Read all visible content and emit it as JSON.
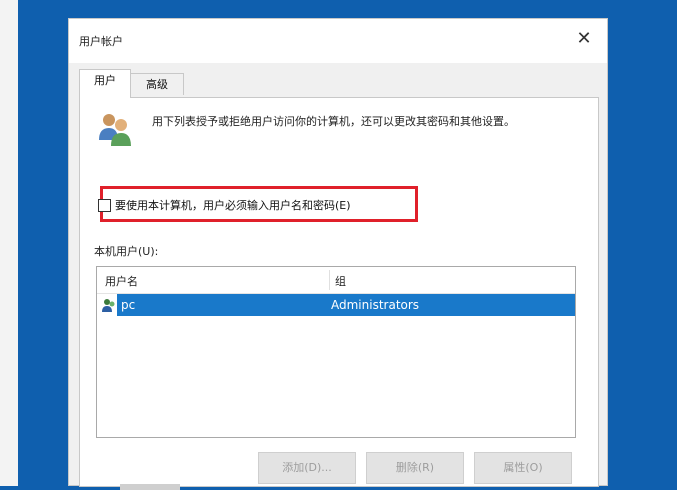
{
  "window": {
    "title": "用户帐户",
    "close_glyph": "✕"
  },
  "tabs": [
    {
      "label": "用户",
      "active": true
    },
    {
      "label": "高级",
      "active": false
    }
  ],
  "panel": {
    "description": "用下列表授予或拒绝用户访问你的计算机，还可以更改其密码和其他设置。",
    "require_password_checkbox": {
      "label": "要使用本计算机，用户必须输入用户名和密码(E)",
      "checked": false
    },
    "local_users_label": "本机用户(U):",
    "list": {
      "columns": [
        "用户名",
        "组"
      ],
      "rows": [
        {
          "name": "pc",
          "group": "Administrators",
          "selected": true
        }
      ]
    },
    "buttons": {
      "add": "添加(D)...",
      "remove": "删除(R)",
      "properties": "属性(O)"
    }
  },
  "colors": {
    "desktop": "#0f5fae",
    "selection": "#1979ca",
    "highlight_box": "#e0202a"
  },
  "icons": {
    "users": "users-icon",
    "row_user": "user-icon",
    "close": "close-icon"
  }
}
